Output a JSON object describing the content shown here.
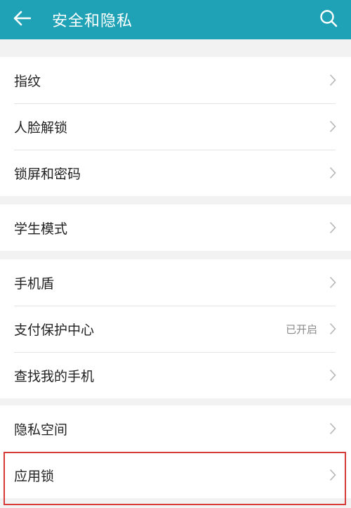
{
  "header": {
    "title": "安全和隐私",
    "back_icon": "arrow-left-icon",
    "search_icon": "search-icon",
    "color": "#1fa2b6"
  },
  "groups": [
    {
      "items": [
        {
          "label": "指纹"
        },
        {
          "label": "人脸解锁"
        },
        {
          "label": "锁屏和密码"
        }
      ]
    },
    {
      "items": [
        {
          "label": "学生模式"
        }
      ]
    },
    {
      "items": [
        {
          "label": "手机盾"
        },
        {
          "label": "支付保护中心",
          "status": "已开启"
        },
        {
          "label": "查找我的手机"
        }
      ]
    },
    {
      "items": [
        {
          "label": "隐私空间"
        },
        {
          "label": "应用锁"
        }
      ]
    }
  ],
  "highlight_color": "#d63a3a"
}
